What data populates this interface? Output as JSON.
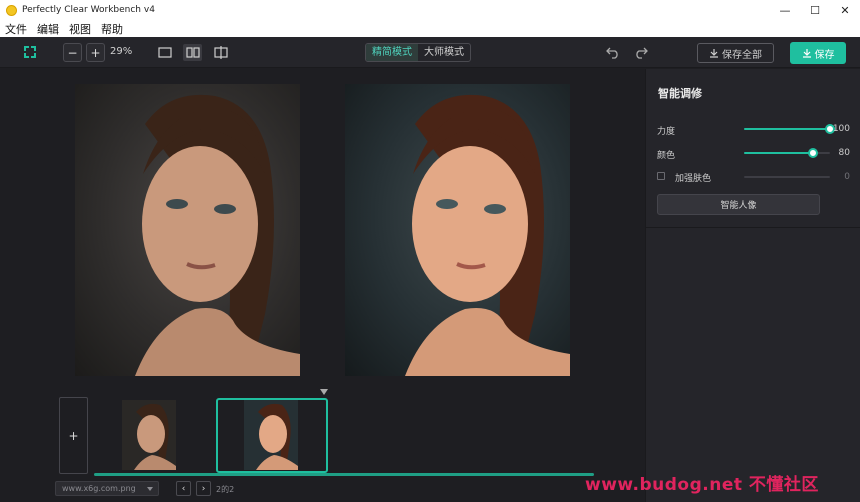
{
  "window": {
    "title": "Perfectly Clear Workbench v4",
    "minimize": "—",
    "maximize": "☐",
    "close": "✕"
  },
  "menu": [
    "文件",
    "编辑",
    "视图",
    "帮助"
  ],
  "toolbar": {
    "zoom_out": "−",
    "zoom_in": "+",
    "zoom_value": "29%",
    "modes": [
      "精简模式",
      "大师模式"
    ],
    "active_mode": "精简模式",
    "save_all_label": "保存全部",
    "save_label": "保存"
  },
  "panel": {
    "title": "智能调修",
    "sliders": [
      {
        "label": "力度",
        "value": "100",
        "fraction": 1.0
      },
      {
        "label": "颜色",
        "value": "80",
        "fraction": 0.8
      }
    ],
    "skin_toggle": {
      "label": "加强肤色",
      "value": "0",
      "checked": false
    },
    "smart_button": "智能人像"
  },
  "filmstrip": {
    "add_label": "+",
    "file_name": "www.x6g.com.png",
    "page_indicator": "2的2",
    "prev": "‹",
    "next": "›"
  },
  "watermark": "www.budog.net 不懂社区",
  "colors": {
    "accent": "#1fbf9f",
    "bg": "#1e1e22",
    "panel": "#25252a"
  }
}
